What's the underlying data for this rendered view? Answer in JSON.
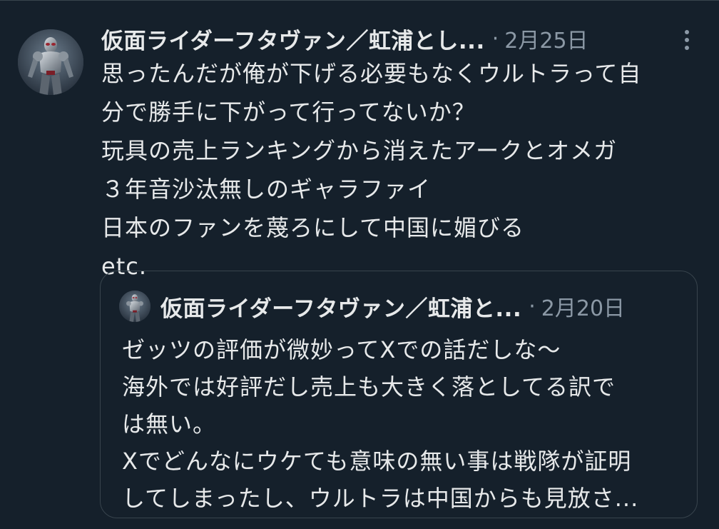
{
  "tweet": {
    "author_name": "仮面ライダーフタヴァン／虹浦とし...",
    "separator": "·",
    "timestamp": "2月25日",
    "body_lines": [
      "思ったんだが俺が下げる必要もなくウルトラって自",
      "分で勝手に下がって行ってないか？",
      "玩具の売上ランキングから消えたアークとオメガ",
      "３年音沙汰無しのギャラファイ",
      "日本のファンを蔑ろにして中国に媚びる",
      "etc."
    ],
    "more_icon": "more-vertical-icon"
  },
  "quoted_tweet": {
    "author_name": "仮面ライダーフタヴァン／虹浦と...",
    "separator": "·",
    "timestamp": "2月20日",
    "body_lines": [
      "ゼッツの評価が微妙ってXでの話だしな〜",
      "海外では好評だし売上も大きく落としてる訳で",
      "は無い。",
      "Xでどんなにウケても意味の無い事は戦隊が証明",
      "してしまったし、ウルトラは中国からも見放さ..."
    ]
  },
  "colors": {
    "background": "#15202b",
    "text": "#e7e9ea",
    "secondary_text": "#8b98a5",
    "border": "#38444d"
  }
}
